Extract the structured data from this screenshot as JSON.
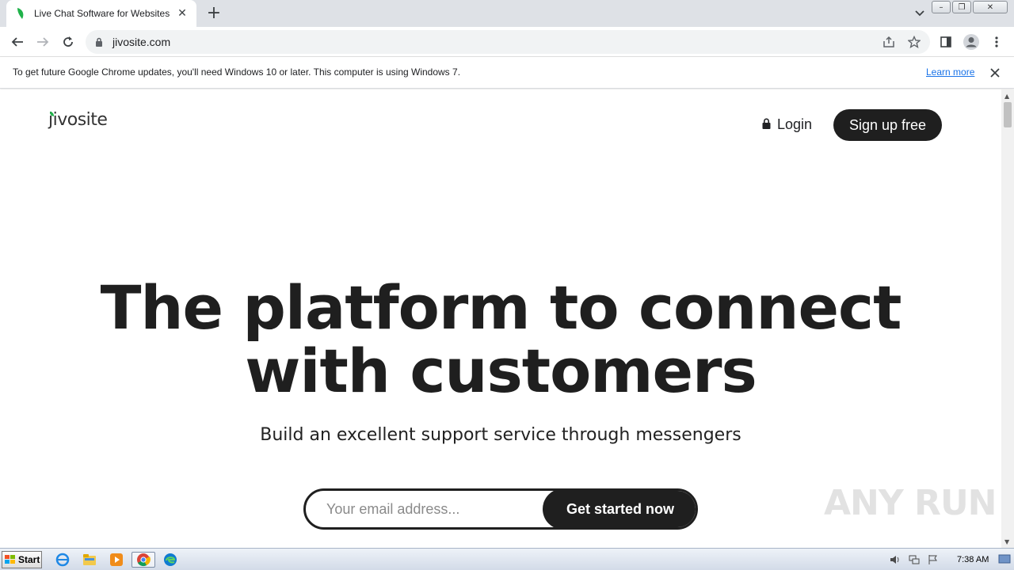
{
  "browser": {
    "tab": {
      "title": "Live Chat Software for Websites | Ji",
      "close_glyph": "✕"
    },
    "new_tab_glyph": "+",
    "window_controls": {
      "minimize": "–",
      "restore": "❐",
      "close": "✕"
    },
    "url": "jivosite.com"
  },
  "infobar": {
    "message": "To get future Google Chrome updates, you'll need Windows 10 or later. This computer is using Windows 7.",
    "link": "Learn more"
  },
  "page": {
    "logo": "jivosite",
    "nav": {
      "login": "Login",
      "signup": "Sign up free"
    },
    "hero": {
      "headline_line1": "The platform to connect",
      "headline_line2": "with customers",
      "subline": "Build an excellent support service through messengers",
      "email_placeholder": "Your email address...",
      "cta": "Get started now"
    },
    "watermark": "ANY RUN"
  },
  "taskbar": {
    "start_label": "Start",
    "clock": "7:38 AM",
    "apps": [
      "ie-icon",
      "explorer-icon",
      "media-player-icon",
      "chrome-icon",
      "edge-icon"
    ]
  },
  "colors": {
    "accent_dark": "#1f1f1f",
    "logo_leaf": "#20b24a",
    "link_blue": "#1a73e8"
  }
}
